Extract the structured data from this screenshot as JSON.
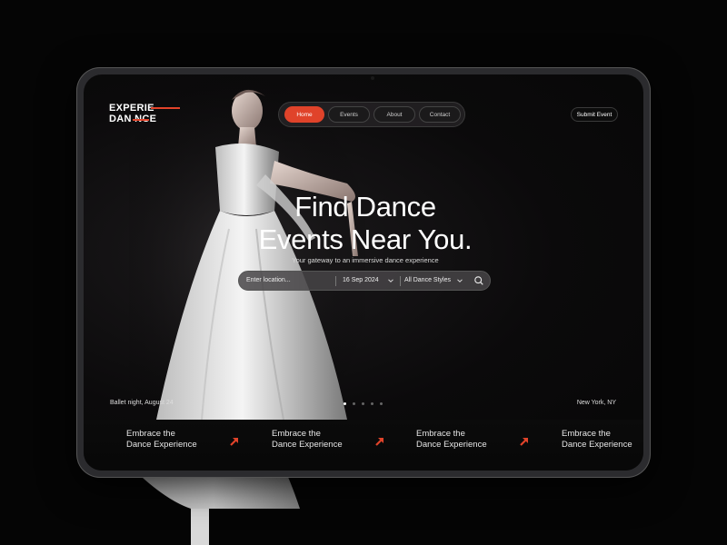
{
  "brand": {
    "logo_line1": "EXPERIE",
    "logo_line2": "DAN   NCE",
    "accent": "#e0432a"
  },
  "nav": {
    "items": [
      {
        "label": "Home",
        "active": true
      },
      {
        "label": "Events",
        "active": false
      },
      {
        "label": "About",
        "active": false
      },
      {
        "label": "Contact",
        "active": false
      }
    ],
    "submit_label": "Submit Event"
  },
  "hero": {
    "title_line1": "Find Dance",
    "title_line2": "Events Near You.",
    "subtitle": "Your gateway to an immersive dance experience"
  },
  "search": {
    "location_placeholder": "Enter location...",
    "date_value": "16 Sep 2024",
    "style_value": "All Dance Styles",
    "icons": [
      "chevron-down-icon",
      "search-icon"
    ]
  },
  "slider": {
    "caption_left": "Ballet night, August 24",
    "caption_right": "New York, NY",
    "dots": 5,
    "active_dot": 1
  },
  "cards": [
    {
      "line1": "Embrace the",
      "line2": "Dance Experience",
      "icon": "arrow-up-right-icon"
    },
    {
      "line1": "Embrace the",
      "line2": "Dance Experience",
      "icon": "arrow-up-right-icon"
    },
    {
      "line1": "Embrace the",
      "line2": "Dance Experience",
      "icon": "arrow-up-right-icon"
    },
    {
      "line1": "Embrace the",
      "line2": "Dance Experience",
      "icon": "arrow-up-right-icon"
    }
  ]
}
